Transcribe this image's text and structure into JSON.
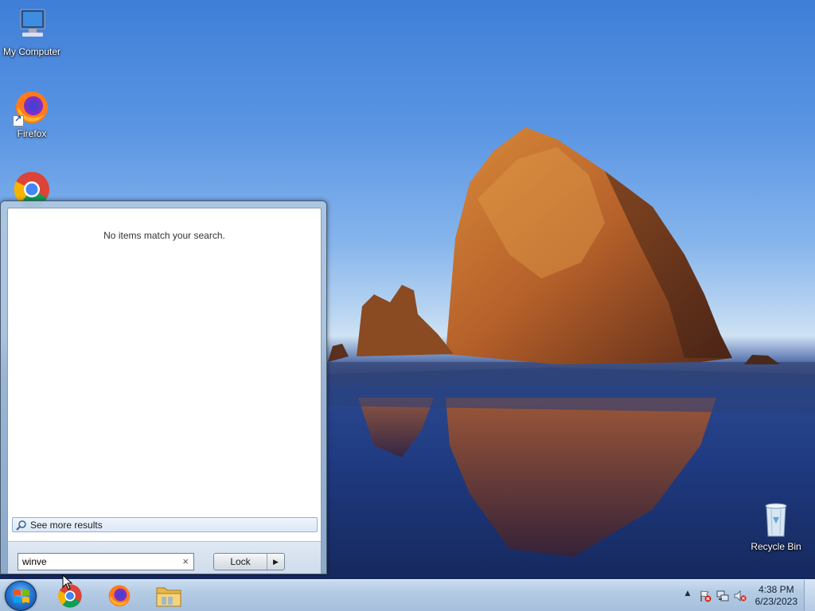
{
  "desktop": {
    "icons": [
      {
        "label": "My Computer",
        "icon": "computer-icon"
      },
      {
        "label": "Firefox",
        "icon": "firefox-icon"
      },
      {
        "label": "Google Chrome",
        "icon": "chrome-icon"
      },
      {
        "label": "Recycle Bin",
        "icon": "recycle-bin-icon"
      }
    ]
  },
  "start_menu": {
    "no_results_text": "No items match your search.",
    "see_more_label": "See more results",
    "search": {
      "value": "winve",
      "clear_glyph": "×"
    },
    "power_button": {
      "label": "Lock",
      "arrow_glyph": "▶"
    }
  },
  "taskbar": {
    "pinned": [
      {
        "name": "chrome",
        "icon": "chrome-icon"
      },
      {
        "name": "firefox",
        "icon": "firefox-icon"
      },
      {
        "name": "file-explorer",
        "icon": "folder-icon"
      }
    ],
    "tray": {
      "show_hidden_glyph": "▲",
      "icons": [
        "action-center-flag-icon",
        "network-icon",
        "volume-muted-icon"
      ]
    },
    "clock": {
      "time": "4:38 PM",
      "date": "6/23/2023"
    }
  },
  "colors": {
    "taskbar": "#b4cbe4",
    "start_menu_frame": "#a9c2dc",
    "sky": "#5a95e3",
    "water": "#1f3a80"
  }
}
